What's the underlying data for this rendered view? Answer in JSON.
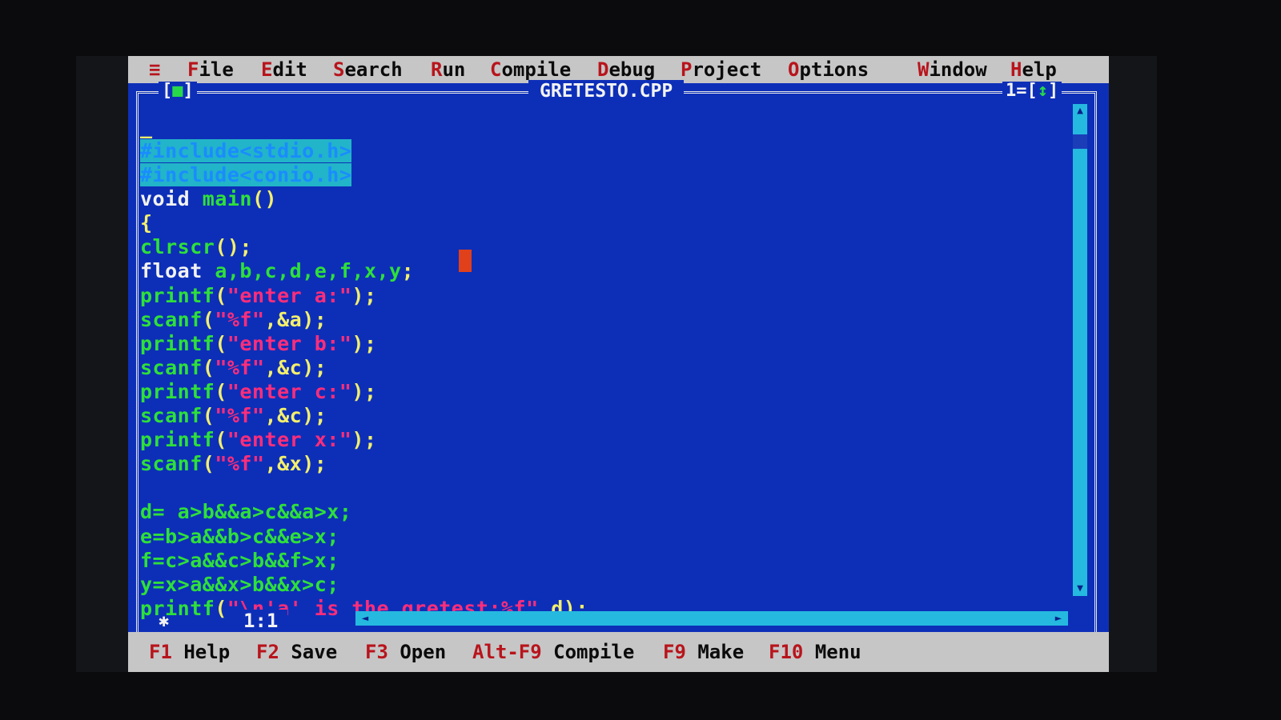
{
  "menu": {
    "system_icon": "≡",
    "items": [
      {
        "hot": "F",
        "rest": "ile"
      },
      {
        "hot": "E",
        "rest": "dit"
      },
      {
        "hot": "S",
        "rest": "earch"
      },
      {
        "hot": "R",
        "rest": "un"
      },
      {
        "hot": "C",
        "rest": "ompile"
      },
      {
        "hot": "D",
        "rest": "ebug"
      },
      {
        "hot": "P",
        "rest": "roject"
      },
      {
        "hot": "O",
        "rest": "ptions"
      },
      {
        "hot": "W",
        "rest": "indow"
      },
      {
        "hot": "H",
        "rest": "elp"
      }
    ]
  },
  "window": {
    "title": "GRETESTO.CPP",
    "close_box": {
      "open": "[",
      "mark": "■",
      "close": "]"
    },
    "number": {
      "prefix": "1=[",
      "mark": "↕",
      "suffix": "]"
    },
    "cursor_position": "1:1"
  },
  "code": {
    "top_cursor": "_",
    "include1": "#include<stdio.h>",
    "include2": "#include<conio.h>",
    "main_kw": "void",
    "main_id": "main",
    "main_paren": "()",
    "open_brace": "{",
    "clrscr": "clrscr",
    "clrscr_p": "();",
    "float_kw": "float",
    "float_vars": "a,b,c,d,e,f,x,y",
    "semicolon": ";",
    "printf": "printf",
    "scanf": "scanf",
    "lp": "(",
    "rp": ");",
    "str_a": "\"enter a:\"",
    "str_b": "\"enter b:\"",
    "str_c": "\"enter c:\"",
    "str_x": "\"enter x:\"",
    "fmt": "\"%f\"",
    "arg_a": ",&a",
    "arg_c": ",&c",
    "arg_x": ",&x",
    "expr_d": "d= a>b&&a>c&&a>x;",
    "expr_e": "e=b>a&&b>c&&e>x;",
    "expr_f": "f=c>a&&c>b&&f>x;",
    "expr_y": "y=x>a&&x>b&&x>c;",
    "last_str": "\"\\n'a' is the gretest:%f\"",
    "last_arg": ",d"
  },
  "statusbar": [
    {
      "key": "F1",
      "label": "Help"
    },
    {
      "key": "F2",
      "label": "Save"
    },
    {
      "key": "F3",
      "label": "Open"
    },
    {
      "key": "Alt-F9",
      "label": "Compile"
    },
    {
      "key": "F9",
      "label": "Make"
    },
    {
      "key": "F10",
      "label": "Menu"
    }
  ],
  "colors": {
    "editor_bg": "#0d2fb8",
    "menu_bg": "#c6c6c6",
    "hotkey": "#b8141c",
    "identifier": "#2ee03a",
    "string": "#ff2d7a",
    "keyword": "#f2f2f2",
    "punct": "#f3ef6c"
  }
}
